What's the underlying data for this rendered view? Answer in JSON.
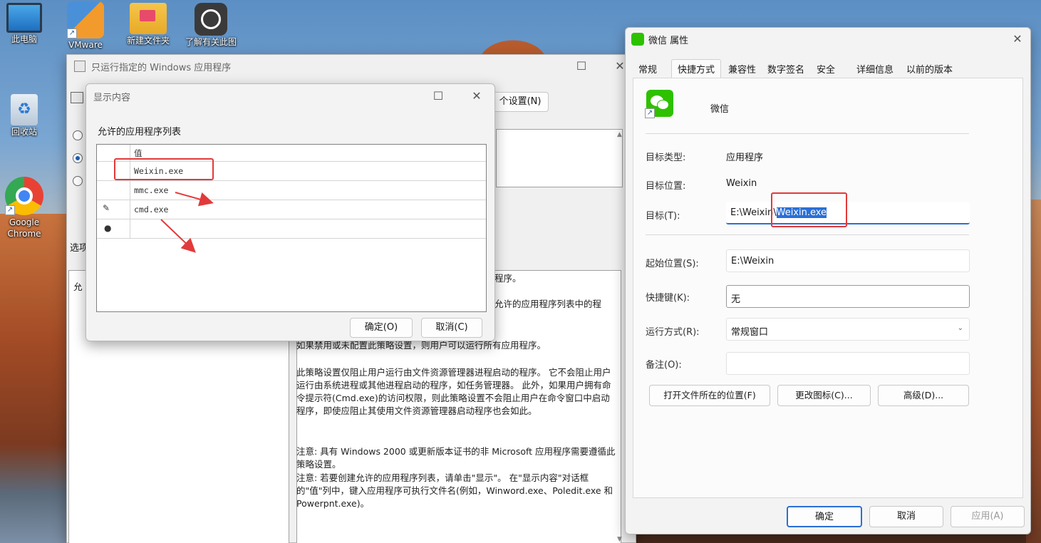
{
  "desktop": {
    "icons": [
      {
        "label": "此电脑",
        "icon": "computer-icon"
      },
      {
        "label": "VMware",
        "icon": "vmware-icon"
      },
      {
        "label": "新建文件夹",
        "icon": "folder-icon"
      },
      {
        "label": "了解有关此图",
        "icon": "camera-info-icon"
      },
      {
        "label": "回收站",
        "icon": "recycle-bin-icon"
      },
      {
        "label": "Google Chrome",
        "icon": "chrome-icon"
      }
    ]
  },
  "policy_window": {
    "title": "只运行指定的 Windows 应用程序",
    "settings_button": "个设置(N)",
    "options_label": "选项",
    "allow_label": "允",
    "help_lines": [
      "程序。",
      "允许的应用程序列表中的程"
    ],
    "help_p1": "如果禁用或未配置此策略设置，则用户可以运行所有应用程序。",
    "help_p2": "此策略设置仅阻止用户运行由文件资源管理器进程启动的程序。 它不会阻止用户运行由系统进程或其他进程启动的程序，如任务管理器。 此外，如果用户拥有命令提示符(Cmd.exe)的访问权限，则此策略设置不会阻止用户在命令窗口中启动程序，即使应阻止其使用文件资源管理器启动程序也会如此。",
    "help_p3": "注意: 具有 Windows 2000 或更新版本证书的非 Microsoft 应用程序需要遵循此策略设置。",
    "help_p4": "注意: 若要创建允许的应用程序列表，请单击\"显示\"。 在\"显示内容\"对话框的\"值\"列中，键入应用程序可执行文件名(例如，Winword.exe、Poledit.exe 和 Powerpnt.exe)。"
  },
  "show_dialog": {
    "title": "显示内容",
    "list_label": "允许的应用程序列表",
    "column_header": "值",
    "rows": [
      {
        "value": "Weixin.exe"
      },
      {
        "value": "mmc.exe"
      },
      {
        "value": "cmd.exe"
      },
      {
        "value": ""
      }
    ],
    "ok_button": "确定(O)",
    "cancel_button": "取消(C)"
  },
  "props_window": {
    "title": "微信 属性",
    "tabs": [
      "常规",
      "快捷方式",
      "兼容性",
      "数字签名",
      "安全",
      "详细信息",
      "以前的版本"
    ],
    "app_name": "微信",
    "target_type_label": "目标类型:",
    "target_type_value": "应用程序",
    "target_location_label": "目标位置:",
    "target_location_value": "Weixin",
    "target_label": "目标(T):",
    "target_value_prefix": "E:\\Weixin\\",
    "target_value_selected": "Weixin.exe",
    "start_in_label": "起始位置(S):",
    "start_in_value": "E:\\Weixin",
    "hotkey_label": "快捷键(K):",
    "hotkey_value": "无",
    "run_label": "运行方式(R):",
    "run_value": "常规窗口",
    "comment_label": "备注(O):",
    "comment_value": "",
    "open_location_button": "打开文件所在的位置(F)",
    "change_icon_button": "更改图标(C)...",
    "advanced_button": "高级(D)...",
    "ok_button": "确定",
    "cancel_button": "取消",
    "apply_button": "应用(A)"
  },
  "colors": {
    "highlight": "#e23a3a",
    "selection": "#2a6fd6",
    "wechat_green": "#2dc100"
  }
}
